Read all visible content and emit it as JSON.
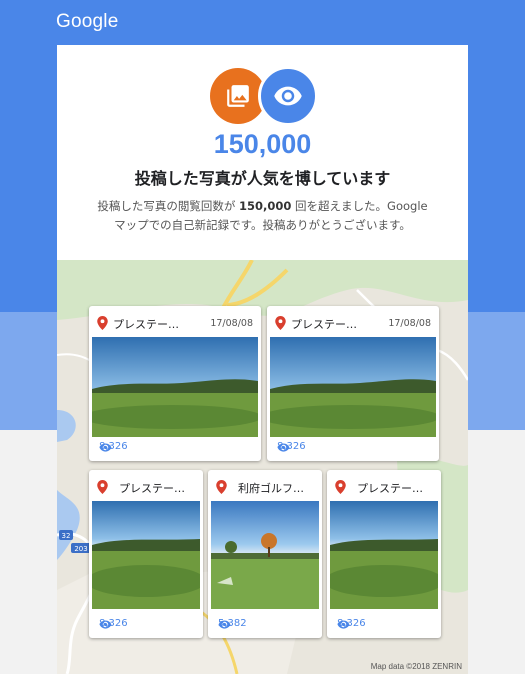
{
  "brand": {
    "logo": "Google"
  },
  "hero": {
    "count": "150,000",
    "headline": "投稿した写真が人気を博しています",
    "desc_pre": "投稿した写真の閲覧回数が ",
    "desc_bold": "150,000",
    "desc_post": " 回を超えました。Google マップでの自己新記録です。投稿ありがとうございます。"
  },
  "photos": [
    {
      "title": "プレステー…",
      "date": "17/08/08",
      "views": "8,326"
    },
    {
      "title": "プレステー…",
      "date": "17/08/08",
      "views": "8,326"
    },
    {
      "title": "プレステー…",
      "date": "",
      "views": "8,326"
    },
    {
      "title": "利府ゴルフ…",
      "date": "",
      "views": "5,382"
    },
    {
      "title": "プレステー…",
      "date": "",
      "views": "8,326"
    }
  ],
  "map": {
    "attribution": "Map data ©2018 ZENRIN",
    "road_labels": [
      "32",
      "203"
    ]
  },
  "colors": {
    "brand_blue": "#4a86e8",
    "orange": "#e8711e",
    "pin_red": "#d93f2e"
  },
  "icons": [
    "photo-library-icon",
    "eye-icon",
    "map-pin-icon"
  ]
}
